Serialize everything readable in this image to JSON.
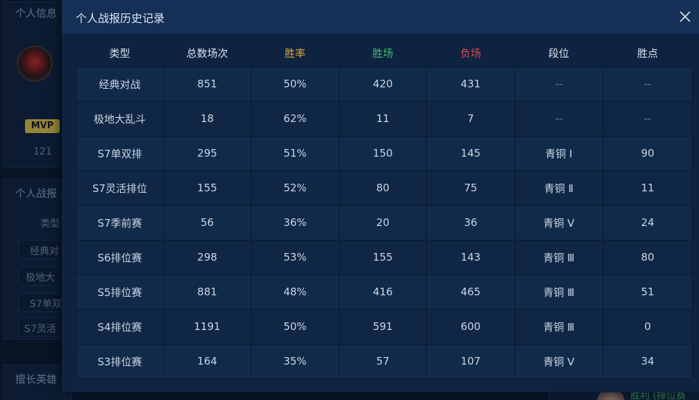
{
  "background": {
    "panel1_title": "个人信息",
    "mvp_label": "MVP",
    "mvp_count": "121",
    "panel2_title": "个人战报",
    "panel2_col": "类型",
    "panel2_rows": [
      "经典对",
      "极地大",
      "S7单双",
      "S7灵活"
    ],
    "panel3_title": "擅长英雄",
    "footer_text": "胜利 (排位赛"
  },
  "modal": {
    "title": "个人战报历史记录",
    "close_icon": "close-icon",
    "columns": [
      "类型",
      "总数场次",
      "胜率",
      "胜场",
      "负场",
      "段位",
      "胜点"
    ],
    "rows": [
      [
        "经典对战",
        "851",
        "50%",
        "420",
        "431",
        "--",
        "--"
      ],
      [
        "极地大乱斗",
        "18",
        "62%",
        "11",
        "7",
        "--",
        "--"
      ],
      [
        "S7单双排",
        "295",
        "51%",
        "150",
        "145",
        "青铜 Ⅰ",
        "90"
      ],
      [
        "S7灵活排位",
        "155",
        "52%",
        "80",
        "75",
        "青铜 Ⅱ",
        "11"
      ],
      [
        "S7季前赛",
        "56",
        "36%",
        "20",
        "36",
        "青铜 Ⅴ",
        "24"
      ],
      [
        "S6排位赛",
        "298",
        "53%",
        "155",
        "143",
        "青铜 Ⅲ",
        "80"
      ],
      [
        "S5排位赛",
        "881",
        "48%",
        "416",
        "465",
        "青铜 Ⅲ",
        "51"
      ],
      [
        "S4排位赛",
        "1191",
        "50%",
        "591",
        "600",
        "青铜 Ⅲ",
        "0"
      ],
      [
        "S3排位赛",
        "164",
        "35%",
        "57",
        "107",
        "青铜 Ⅴ",
        "34"
      ]
    ]
  },
  "colors": {
    "winrate_header": "#e0a33c",
    "wins_header": "#3fbf6a",
    "losses_header": "#e04848",
    "modal_bg": "#0d2340",
    "header_bg": "#143056"
  }
}
